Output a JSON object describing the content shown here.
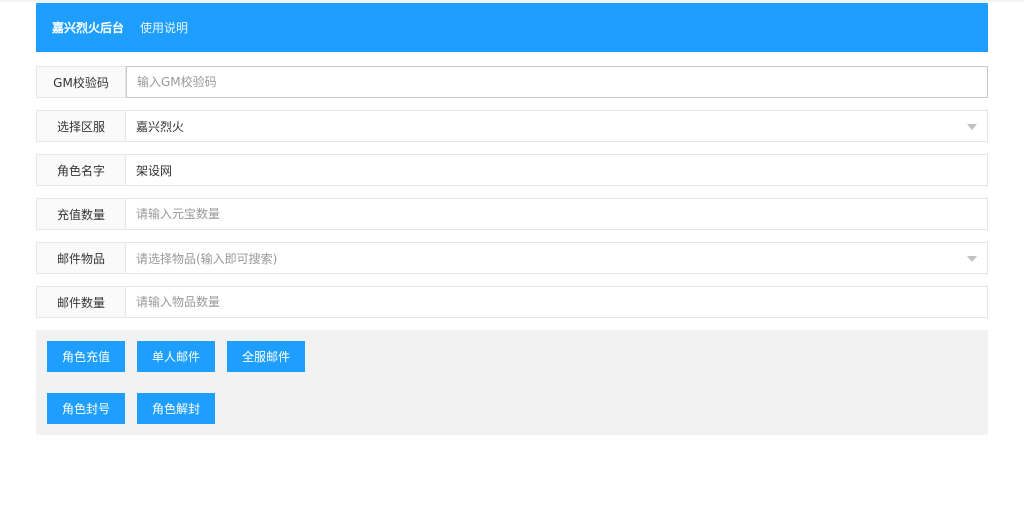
{
  "header": {
    "brand": "嘉兴烈火后台",
    "help_link": "使用说明",
    "bg_color": "#1e9fff"
  },
  "form": {
    "gm_code": {
      "label": "GM校验码",
      "placeholder": "输入GM校验码",
      "value": ""
    },
    "server": {
      "label": "选择区服",
      "value": "嘉兴烈火"
    },
    "role_name": {
      "label": "角色名字",
      "value": "架设网"
    },
    "recharge": {
      "label": "充值数量",
      "placeholder": "请输入元宝数量",
      "value": ""
    },
    "mail_item": {
      "label": "邮件物品",
      "placeholder": "请选择物品(输入即可搜索)"
    },
    "mail_count": {
      "label": "邮件数量",
      "placeholder": "请输入物品数量",
      "value": ""
    }
  },
  "actions": {
    "recharge_btn": "角色充值",
    "single_mail_btn": "单人邮件",
    "all_mail_btn": "全服邮件",
    "ban_btn": "角色封号",
    "unban_btn": "角色解封"
  }
}
